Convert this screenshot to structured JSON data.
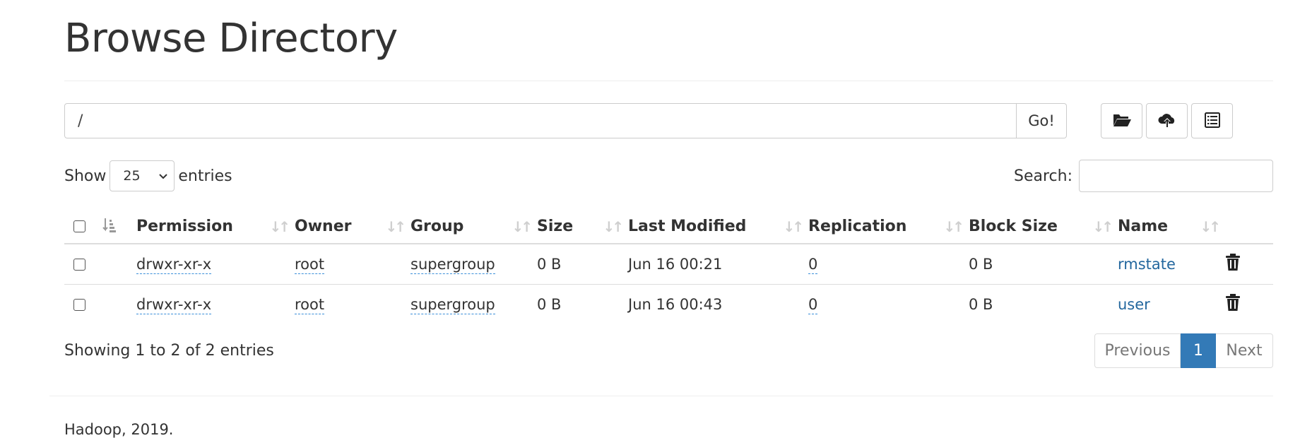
{
  "page": {
    "title": "Browse Directory"
  },
  "path_bar": {
    "value": "/",
    "go_label": "Go!"
  },
  "toolbar": {
    "icons": [
      "folder-open-icon",
      "cloud-upload-icon",
      "list-alt-icon"
    ]
  },
  "length": {
    "show_label": "Show",
    "selected": "25",
    "entries_label": "entries"
  },
  "search": {
    "label": "Search:",
    "value": ""
  },
  "table": {
    "columns": [
      "Permission",
      "Owner",
      "Group",
      "Size",
      "Last Modified",
      "Replication",
      "Block Size",
      "Name"
    ],
    "rows": [
      {
        "permission": "drwxr-xr-x",
        "owner": "root",
        "group": "supergroup",
        "size": "0 B",
        "last_modified": "Jun 16 00:21",
        "replication": "0",
        "block_size": "0 B",
        "name": "rmstate"
      },
      {
        "permission": "drwxr-xr-x",
        "owner": "root",
        "group": "supergroup",
        "size": "0 B",
        "last_modified": "Jun 16 00:43",
        "replication": "0",
        "block_size": "0 B",
        "name": "user"
      }
    ]
  },
  "info": {
    "text": "Showing 1 to 2 of 2 entries"
  },
  "pagination": {
    "previous": "Previous",
    "current": "1",
    "next": "Next"
  },
  "footer": {
    "text": "Hadoop, 2019."
  },
  "colors": {
    "link": "#23679e",
    "accent": "#337ab7",
    "border": "#dddddd",
    "text": "#333333"
  }
}
